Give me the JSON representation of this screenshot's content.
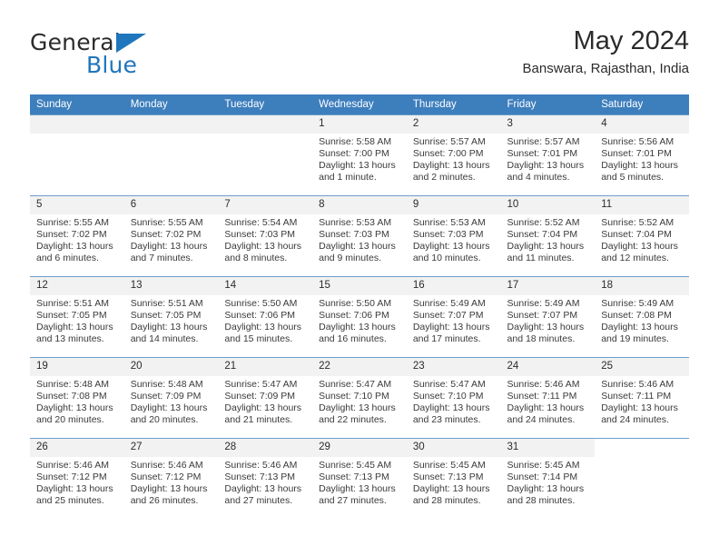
{
  "brand": {
    "name_part1": "General",
    "name_part2": "Blue",
    "logo_icon": "triangle-flag-icon"
  },
  "header": {
    "title": "May 2024",
    "subtitle": "Banswara, Rajasthan, India"
  },
  "colors": {
    "header_blue": "#3d7ebd",
    "brand_blue": "#1f76bc",
    "daynum_band": "#f2f2f2",
    "row_divider": "#6f9ecb"
  },
  "weekday_headers": [
    "Sunday",
    "Monday",
    "Tuesday",
    "Wednesday",
    "Thursday",
    "Friday",
    "Saturday"
  ],
  "labels": {
    "sunrise_prefix": "Sunrise:",
    "sunset_prefix": "Sunset:",
    "daylight_prefix": "Daylight:"
  },
  "weeks": [
    [
      {
        "day": "",
        "empty": true,
        "blank": false
      },
      {
        "day": "",
        "empty": true,
        "blank": false
      },
      {
        "day": "",
        "empty": true,
        "blank": false
      },
      {
        "day": "1",
        "sunrise": "Sunrise: 5:58 AM",
        "sunset": "Sunset: 7:00 PM",
        "daylight_l1": "Daylight: 13 hours",
        "daylight_l2": "and 1 minute."
      },
      {
        "day": "2",
        "sunrise": "Sunrise: 5:57 AM",
        "sunset": "Sunset: 7:00 PM",
        "daylight_l1": "Daylight: 13 hours",
        "daylight_l2": "and 2 minutes."
      },
      {
        "day": "3",
        "sunrise": "Sunrise: 5:57 AM",
        "sunset": "Sunset: 7:01 PM",
        "daylight_l1": "Daylight: 13 hours",
        "daylight_l2": "and 4 minutes."
      },
      {
        "day": "4",
        "sunrise": "Sunrise: 5:56 AM",
        "sunset": "Sunset: 7:01 PM",
        "daylight_l1": "Daylight: 13 hours",
        "daylight_l2": "and 5 minutes."
      }
    ],
    [
      {
        "day": "5",
        "sunrise": "Sunrise: 5:55 AM",
        "sunset": "Sunset: 7:02 PM",
        "daylight_l1": "Daylight: 13 hours",
        "daylight_l2": "and 6 minutes."
      },
      {
        "day": "6",
        "sunrise": "Sunrise: 5:55 AM",
        "sunset": "Sunset: 7:02 PM",
        "daylight_l1": "Daylight: 13 hours",
        "daylight_l2": "and 7 minutes."
      },
      {
        "day": "7",
        "sunrise": "Sunrise: 5:54 AM",
        "sunset": "Sunset: 7:03 PM",
        "daylight_l1": "Daylight: 13 hours",
        "daylight_l2": "and 8 minutes."
      },
      {
        "day": "8",
        "sunrise": "Sunrise: 5:53 AM",
        "sunset": "Sunset: 7:03 PM",
        "daylight_l1": "Daylight: 13 hours",
        "daylight_l2": "and 9 minutes."
      },
      {
        "day": "9",
        "sunrise": "Sunrise: 5:53 AM",
        "sunset": "Sunset: 7:03 PM",
        "daylight_l1": "Daylight: 13 hours",
        "daylight_l2": "and 10 minutes."
      },
      {
        "day": "10",
        "sunrise": "Sunrise: 5:52 AM",
        "sunset": "Sunset: 7:04 PM",
        "daylight_l1": "Daylight: 13 hours",
        "daylight_l2": "and 11 minutes."
      },
      {
        "day": "11",
        "sunrise": "Sunrise: 5:52 AM",
        "sunset": "Sunset: 7:04 PM",
        "daylight_l1": "Daylight: 13 hours",
        "daylight_l2": "and 12 minutes."
      }
    ],
    [
      {
        "day": "12",
        "sunrise": "Sunrise: 5:51 AM",
        "sunset": "Sunset: 7:05 PM",
        "daylight_l1": "Daylight: 13 hours",
        "daylight_l2": "and 13 minutes."
      },
      {
        "day": "13",
        "sunrise": "Sunrise: 5:51 AM",
        "sunset": "Sunset: 7:05 PM",
        "daylight_l1": "Daylight: 13 hours",
        "daylight_l2": "and 14 minutes."
      },
      {
        "day": "14",
        "sunrise": "Sunrise: 5:50 AM",
        "sunset": "Sunset: 7:06 PM",
        "daylight_l1": "Daylight: 13 hours",
        "daylight_l2": "and 15 minutes."
      },
      {
        "day": "15",
        "sunrise": "Sunrise: 5:50 AM",
        "sunset": "Sunset: 7:06 PM",
        "daylight_l1": "Daylight: 13 hours",
        "daylight_l2": "and 16 minutes."
      },
      {
        "day": "16",
        "sunrise": "Sunrise: 5:49 AM",
        "sunset": "Sunset: 7:07 PM",
        "daylight_l1": "Daylight: 13 hours",
        "daylight_l2": "and 17 minutes."
      },
      {
        "day": "17",
        "sunrise": "Sunrise: 5:49 AM",
        "sunset": "Sunset: 7:07 PM",
        "daylight_l1": "Daylight: 13 hours",
        "daylight_l2": "and 18 minutes."
      },
      {
        "day": "18",
        "sunrise": "Sunrise: 5:49 AM",
        "sunset": "Sunset: 7:08 PM",
        "daylight_l1": "Daylight: 13 hours",
        "daylight_l2": "and 19 minutes."
      }
    ],
    [
      {
        "day": "19",
        "sunrise": "Sunrise: 5:48 AM",
        "sunset": "Sunset: 7:08 PM",
        "daylight_l1": "Daylight: 13 hours",
        "daylight_l2": "and 20 minutes."
      },
      {
        "day": "20",
        "sunrise": "Sunrise: 5:48 AM",
        "sunset": "Sunset: 7:09 PM",
        "daylight_l1": "Daylight: 13 hours",
        "daylight_l2": "and 20 minutes."
      },
      {
        "day": "21",
        "sunrise": "Sunrise: 5:47 AM",
        "sunset": "Sunset: 7:09 PM",
        "daylight_l1": "Daylight: 13 hours",
        "daylight_l2": "and 21 minutes."
      },
      {
        "day": "22",
        "sunrise": "Sunrise: 5:47 AM",
        "sunset": "Sunset: 7:10 PM",
        "daylight_l1": "Daylight: 13 hours",
        "daylight_l2": "and 22 minutes."
      },
      {
        "day": "23",
        "sunrise": "Sunrise: 5:47 AM",
        "sunset": "Sunset: 7:10 PM",
        "daylight_l1": "Daylight: 13 hours",
        "daylight_l2": "and 23 minutes."
      },
      {
        "day": "24",
        "sunrise": "Sunrise: 5:46 AM",
        "sunset": "Sunset: 7:11 PM",
        "daylight_l1": "Daylight: 13 hours",
        "daylight_l2": "and 24 minutes."
      },
      {
        "day": "25",
        "sunrise": "Sunrise: 5:46 AM",
        "sunset": "Sunset: 7:11 PM",
        "daylight_l1": "Daylight: 13 hours",
        "daylight_l2": "and 24 minutes."
      }
    ],
    [
      {
        "day": "26",
        "sunrise": "Sunrise: 5:46 AM",
        "sunset": "Sunset: 7:12 PM",
        "daylight_l1": "Daylight: 13 hours",
        "daylight_l2": "and 25 minutes."
      },
      {
        "day": "27",
        "sunrise": "Sunrise: 5:46 AM",
        "sunset": "Sunset: 7:12 PM",
        "daylight_l1": "Daylight: 13 hours",
        "daylight_l2": "and 26 minutes."
      },
      {
        "day": "28",
        "sunrise": "Sunrise: 5:46 AM",
        "sunset": "Sunset: 7:13 PM",
        "daylight_l1": "Daylight: 13 hours",
        "daylight_l2": "and 27 minutes."
      },
      {
        "day": "29",
        "sunrise": "Sunrise: 5:45 AM",
        "sunset": "Sunset: 7:13 PM",
        "daylight_l1": "Daylight: 13 hours",
        "daylight_l2": "and 27 minutes."
      },
      {
        "day": "30",
        "sunrise": "Sunrise: 5:45 AM",
        "sunset": "Sunset: 7:13 PM",
        "daylight_l1": "Daylight: 13 hours",
        "daylight_l2": "and 28 minutes."
      },
      {
        "day": "31",
        "sunrise": "Sunrise: 5:45 AM",
        "sunset": "Sunset: 7:14 PM",
        "daylight_l1": "Daylight: 13 hours",
        "daylight_l2": "and 28 minutes."
      },
      {
        "day": "",
        "empty": true,
        "blank": true
      }
    ]
  ]
}
